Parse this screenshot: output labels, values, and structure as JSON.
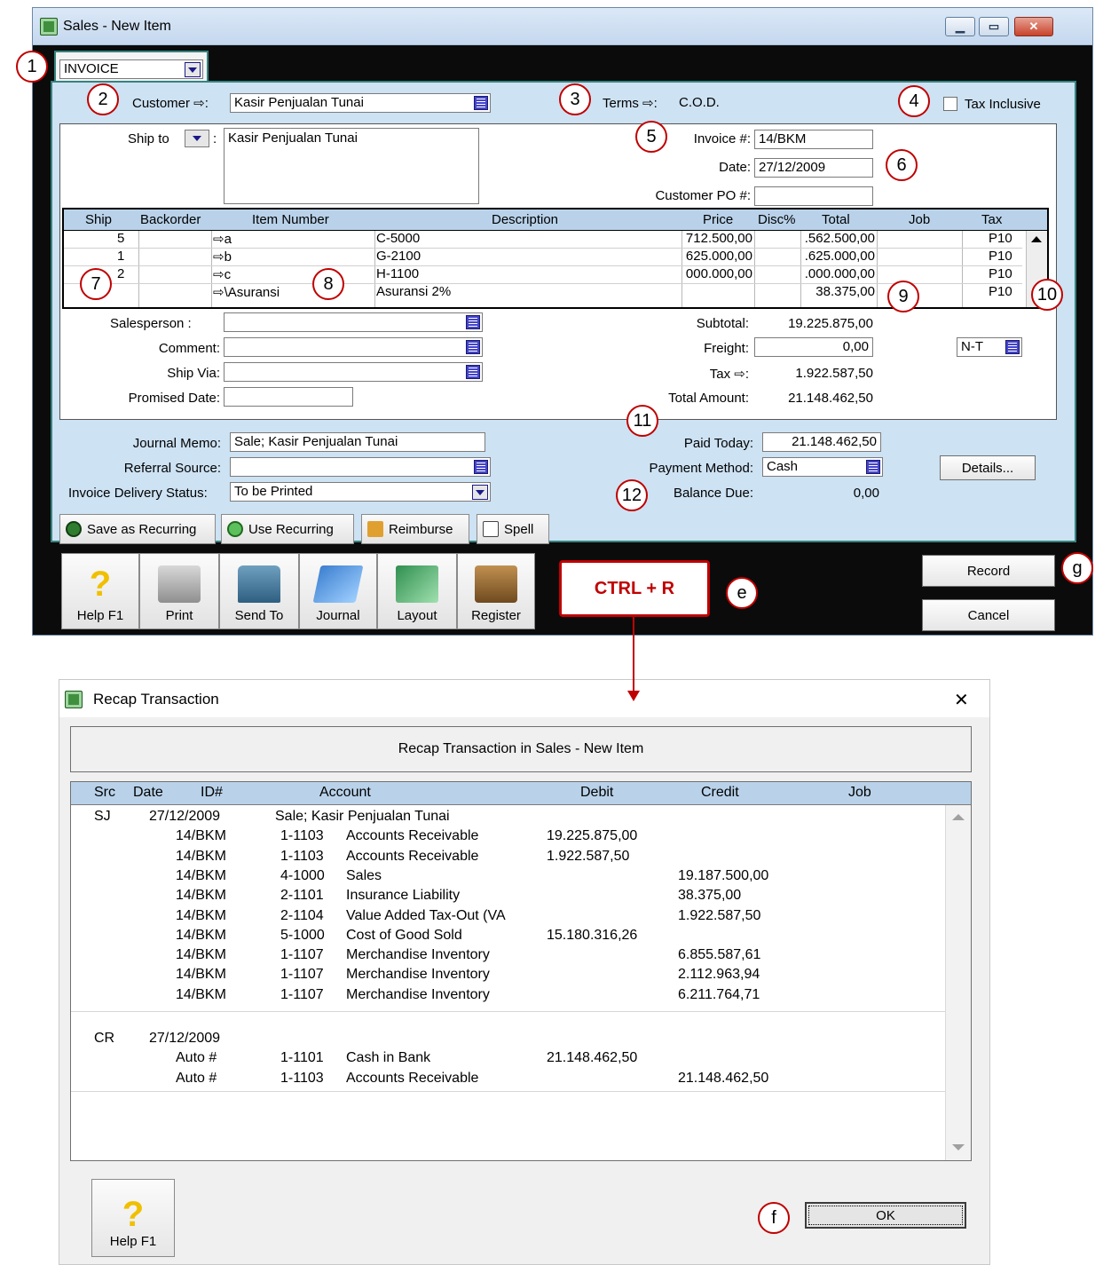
{
  "sales_window": {
    "title": "Sales - New Item",
    "doc_type": "INVOICE",
    "customer_label": "Customer ⇨:",
    "customer_value": "Kasir Penjualan Tunai",
    "terms_label": "Terms ⇨:",
    "terms_value": "C.O.D.",
    "tax_inclusive_label": "Tax Inclusive",
    "tax_inclusive_checked": false,
    "ship_to_label": "Ship to",
    "ship_to_value": "Kasir Penjualan Tunai",
    "invoice_no_label": "Invoice #:",
    "invoice_no": "14/BKM",
    "date_label": "Date:",
    "date": "27/12/2009",
    "customer_po_label": "Customer PO #:",
    "customer_po": "",
    "grid": {
      "headers": {
        "ship": "Ship",
        "backorder": "Backorder",
        "item_number": "Item Number",
        "description": "Description",
        "price": "Price",
        "disc": "Disc%",
        "total": "Total",
        "job": "Job",
        "tax": "Tax"
      },
      "rows": [
        {
          "ship": "5",
          "backorder": "",
          "item_number": "⇨a",
          "description": "C-5000",
          "price": "712.500,00",
          "disc": "",
          "total": ".562.500,00",
          "job": "",
          "tax": "P10"
        },
        {
          "ship": "1",
          "backorder": "",
          "item_number": "⇨b",
          "description": "G-2100",
          "price": "625.000,00",
          "disc": "",
          "total": ".625.000,00",
          "job": "",
          "tax": "P10"
        },
        {
          "ship": "2",
          "backorder": "",
          "item_number": "⇨c",
          "description": "H-1100",
          "price": "000.000,00",
          "disc": "",
          "total": ".000.000,00",
          "job": "",
          "tax": "P10"
        },
        {
          "ship": "",
          "backorder": "",
          "item_number": "⇨\\Asuransi",
          "description": "Asuransi 2%",
          "price": "",
          "disc": "",
          "total": "38.375,00",
          "job": "",
          "tax": "P10"
        }
      ]
    },
    "salesperson_label": "Salesperson :",
    "comment_label": "Comment:",
    "ship_via_label": "Ship Via:",
    "promised_date_label": "Promised Date:",
    "subtotal_label": "Subtotal:",
    "subtotal": "19.225.875,00",
    "freight_label": "Freight:",
    "freight": "0,00",
    "freight_tax": "N-T",
    "tax_label": "Tax ⇨:",
    "tax": "1.922.587,50",
    "total_amount_label": "Total Amount:",
    "total_amount": "21.148.462,50",
    "journal_memo_label": "Journal Memo:",
    "journal_memo": "Sale; Kasir Penjualan Tunai",
    "referral_source_label": "Referral Source:",
    "invoice_delivery_label": "Invoice Delivery Status:",
    "invoice_delivery": "To be Printed",
    "paid_today_label": "Paid Today:",
    "paid_today": "21.148.462,50",
    "payment_method_label": "Payment Method:",
    "payment_method": "Cash",
    "details_label": "Details...",
    "balance_due_label": "Balance Due:",
    "balance_due": "0,00",
    "toolbar": {
      "save_recurring": "Save as Recurring",
      "use_recurring": "Use Recurring",
      "reimburse": "Reimburse",
      "spell": "Spell"
    },
    "bottom_buttons": {
      "help": "Help F1",
      "print": "Print",
      "send_to": "Send To",
      "journal": "Journal",
      "layout": "Layout",
      "register": "Register"
    },
    "record_label": "Record",
    "cancel_label": "Cancel"
  },
  "annotations": {
    "m1": "1",
    "m2": "2",
    "m3": "3",
    "m4": "4",
    "m5": "5",
    "m6": "6",
    "m7": "7",
    "m8": "8",
    "m9": "9",
    "m10": "10",
    "m11": "11",
    "m12": "12",
    "me": "e",
    "mf": "f",
    "mg": "g",
    "shortcut": "CTRL + R"
  },
  "recap_window": {
    "title": "Recap Transaction",
    "close_glyph": "✕",
    "header": "Recap Transaction in Sales - New Item",
    "columns": {
      "src": "Src",
      "date": "Date",
      "id": "ID#",
      "account": "Account",
      "debit": "Debit",
      "credit": "Credit",
      "job": "Job"
    },
    "rows": [
      {
        "src": "SJ",
        "date": "27/12/2009",
        "id": "",
        "acct_no": "",
        "account": "Sale; Kasir Penjualan Tunai",
        "debit": "",
        "credit": ""
      },
      {
        "src": "",
        "date": "",
        "id": "14/BKM",
        "acct_no": "1-1103",
        "account": "Accounts Receivable",
        "debit": "19.225.875,00",
        "credit": ""
      },
      {
        "src": "",
        "date": "",
        "id": "14/BKM",
        "acct_no": "1-1103",
        "account": "Accounts Receivable",
        "debit": "1.922.587,50",
        "credit": ""
      },
      {
        "src": "",
        "date": "",
        "id": "14/BKM",
        "acct_no": "4-1000",
        "account": "Sales",
        "debit": "",
        "credit": "19.187.500,00"
      },
      {
        "src": "",
        "date": "",
        "id": "14/BKM",
        "acct_no": "2-1101",
        "account": "Insurance Liability",
        "debit": "",
        "credit": "38.375,00"
      },
      {
        "src": "",
        "date": "",
        "id": "14/BKM",
        "acct_no": "2-1104",
        "account": "Value Added Tax-Out (VA",
        "debit": "",
        "credit": "1.922.587,50"
      },
      {
        "src": "",
        "date": "",
        "id": "14/BKM",
        "acct_no": "5-1000",
        "account": "Cost of Good Sold",
        "debit": "15.180.316,26",
        "credit": ""
      },
      {
        "src": "",
        "date": "",
        "id": "14/BKM",
        "acct_no": "1-1107",
        "account": "Merchandise Inventory",
        "debit": "",
        "credit": "6.855.587,61"
      },
      {
        "src": "",
        "date": "",
        "id": "14/BKM",
        "acct_no": "1-1107",
        "account": "Merchandise Inventory",
        "debit": "",
        "credit": "2.112.963,94"
      },
      {
        "src": "",
        "date": "",
        "id": "14/BKM",
        "acct_no": "1-1107",
        "account": "Merchandise Inventory",
        "debit": "",
        "credit": "6.211.764,71"
      },
      {
        "src": "CR",
        "date": "27/12/2009",
        "id": "",
        "acct_no": "",
        "account": "",
        "debit": "",
        "credit": ""
      },
      {
        "src": "",
        "date": "",
        "id": "Auto #",
        "acct_no": "1-1101",
        "account": "Cash in Bank",
        "debit": "21.148.462,50",
        "credit": ""
      },
      {
        "src": "",
        "date": "",
        "id": "Auto #",
        "acct_no": "1-1103",
        "account": "Accounts Receivable",
        "debit": "",
        "credit": "21.148.462,50"
      }
    ],
    "ok_label": "OK",
    "help_label": "Help F1"
  }
}
